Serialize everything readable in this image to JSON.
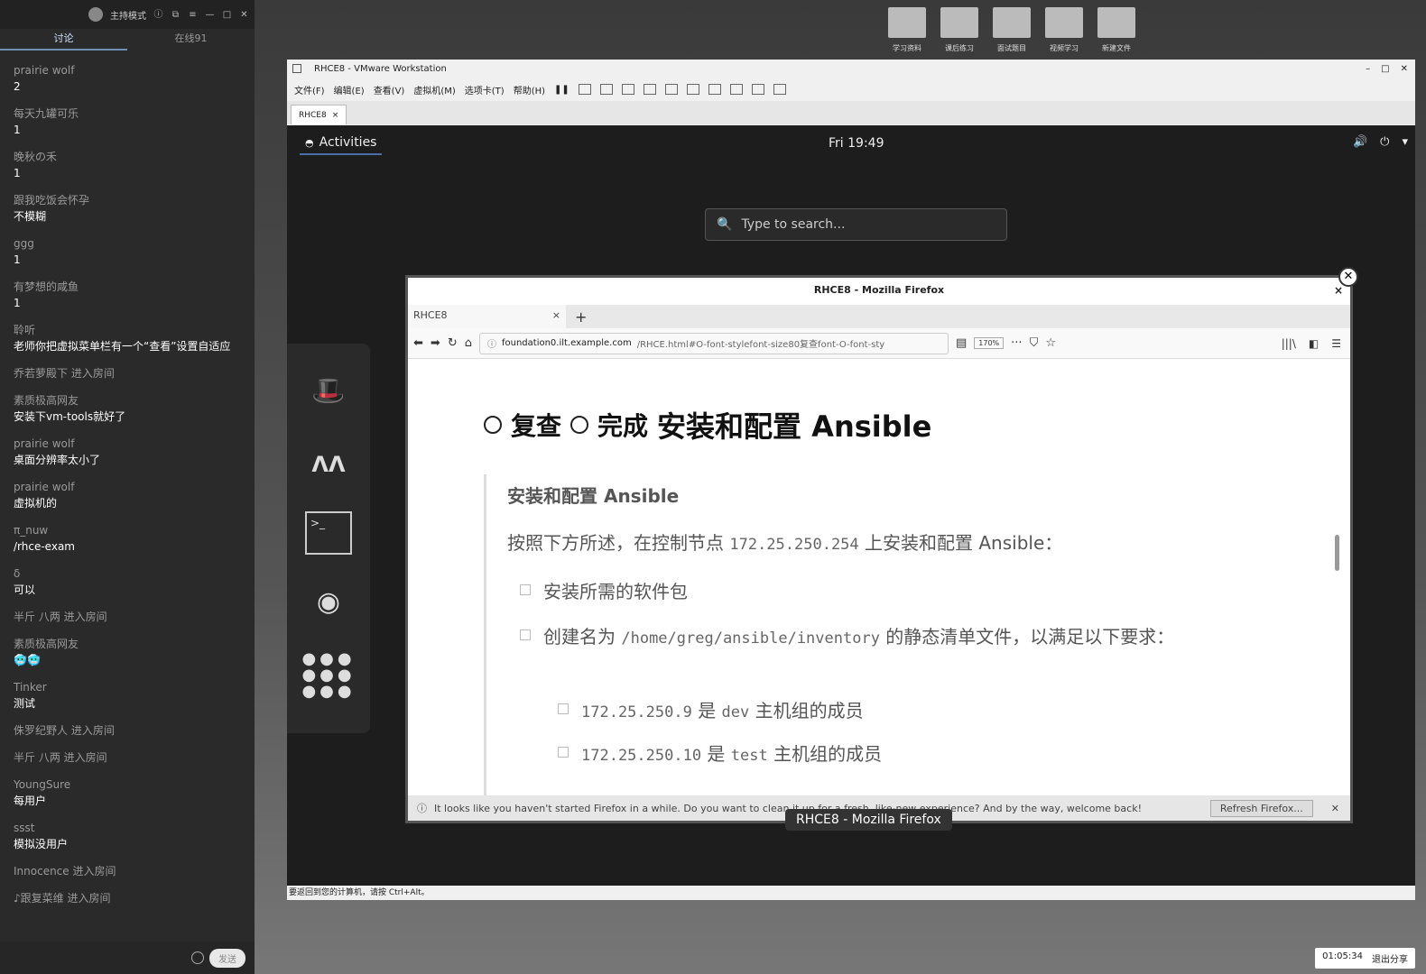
{
  "chat": {
    "host_mode": "主持模式",
    "tabs": [
      "讨论",
      "在线91"
    ],
    "messages": [
      {
        "user": "prairie wolf",
        "text": "2"
      },
      {
        "user": "每天九罐可乐",
        "text": "1"
      },
      {
        "user": "晚秋の禾",
        "text": "1"
      },
      {
        "user": "跟我吃饭会怀孕",
        "text": "不模糊"
      },
      {
        "user": "ggg",
        "text": "1"
      },
      {
        "user": "有梦想的咸鱼",
        "text": "1"
      },
      {
        "user": "聆听",
        "text": "老师你把虚拟菜单栏有一个“查看”设置自适应"
      },
      {
        "system": "乔若萝殿下 进入房间"
      },
      {
        "user": "素质极高网友",
        "text": "安装下vm-tools就好了"
      },
      {
        "user": "prairie wolf",
        "text": "桌面分辨率太小了"
      },
      {
        "user": "prairie wolf",
        "text": "虚拟机的"
      },
      {
        "user": "π_nuw",
        "text": "/rhce-exam"
      },
      {
        "user": "δ",
        "text": "可以"
      },
      {
        "system": "半斤 八两 进入房间"
      },
      {
        "user": "素质极高网友",
        "text": "🥶🥶"
      },
      {
        "user": "Tinker",
        "text": "测试"
      },
      {
        "system": "侏罗纪野人 进入房间"
      },
      {
        "system": "半斤 八两 进入房间"
      },
      {
        "user": "YoungSure",
        "text": "每用户"
      },
      {
        "user": "ssst",
        "text": "模拟没用户"
      },
      {
        "system": "Innocence 进入房间"
      },
      {
        "system": "♪跟复菜维 进入房间"
      }
    ],
    "send_label": "发送"
  },
  "desktop_icons": [
    "学习资料",
    "课后练习",
    "面试题目",
    "视频学习",
    "新建文件"
  ],
  "vmware": {
    "title": "RHCE8 - VMware Workstation",
    "menu": [
      "文件(F)",
      "编辑(E)",
      "查看(V)",
      "虚拟机(M)",
      "选项卡(T)",
      "帮助(H)"
    ],
    "tab": "RHCE8",
    "status": "要返回到您的计算机，请按 Ctrl+Alt。"
  },
  "gnome": {
    "activities": "Activities",
    "clock": "Fri 19:49",
    "search_placeholder": "Type to search..."
  },
  "firefox": {
    "window_title": "RHCE8 - Mozilla Firefox",
    "tab_title": "RHCE8",
    "url_domain": "foundation0.ilt.example.com",
    "url_path": "/RHCE.html#O-font-stylefont-size80复查font-O-font-sty",
    "zoom": "170%",
    "notification": "It looks like you haven't started Firefox in a while. Do you want to clean it up for a fresh, like-new experience? And by the way, welcome back!",
    "notification_button": "Refresh Firefox..."
  },
  "page": {
    "heading_parts": [
      "复查",
      "完成",
      "安装和配置 Ansible"
    ],
    "subheading": "安装和配置 Ansible",
    "intro_pre": "按照下方所述，在控制节点",
    "intro_ip": "172.25.250.254",
    "intro_post": "上安装和配置 Ansible：",
    "item1": "安装所需的软件包",
    "item2_pre": "创建名为",
    "item2_code": "/home/greg/ansible/inventory",
    "item2_post": "的静态清单文件，以满足以下要求：",
    "sub1_ip": "172.25.250.9",
    "sub1_mid": "是",
    "sub1_code": "dev",
    "sub1_post": "主机组的成员",
    "sub2_ip": "172.25.250.10",
    "sub2_mid": "是",
    "sub2_code": "test",
    "sub2_post": "主机组的成员"
  },
  "overview_label": "RHCE8 - Mozilla Firefox",
  "recording": {
    "time": "01:05:34",
    "stop": "退出分享"
  }
}
